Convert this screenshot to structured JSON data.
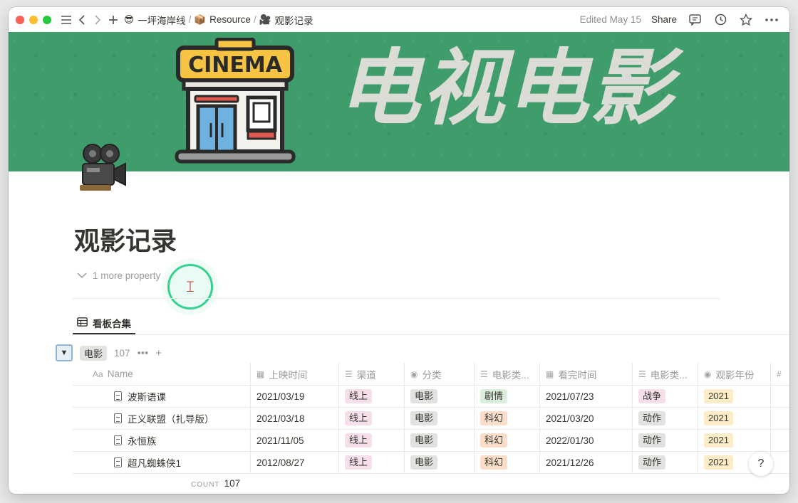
{
  "window": {
    "traffic_colors": [
      "#fe5f57",
      "#febc2e",
      "#28c840"
    ]
  },
  "topbar": {
    "breadcrumbs": [
      {
        "emoji": "😎",
        "label": "一坪海岸线"
      },
      {
        "emoji": "📦",
        "label": "Resource"
      },
      {
        "emoji": "🎥",
        "label": "观影记录"
      }
    ],
    "separator": "/",
    "edited": "Edited May 15",
    "share": "Share"
  },
  "cover": {
    "title": "电视电影",
    "sign_text": "CINEMA",
    "bg_color": "#3f9c6b"
  },
  "page": {
    "icon": "movie-camera-icon",
    "title": "观影记录",
    "more_property": "1 more property"
  },
  "view": {
    "tab_label": "看板合集"
  },
  "group": {
    "tag": "电影",
    "count": "107"
  },
  "table": {
    "columns": [
      {
        "icon": "Aa",
        "label": "Name"
      },
      {
        "icon": "▦",
        "label": "上映时间"
      },
      {
        "icon": "☰",
        "label": "渠道"
      },
      {
        "icon": "◉",
        "label": "分类"
      },
      {
        "icon": "☰",
        "label": "电影类..."
      },
      {
        "icon": "▦",
        "label": "看完时间"
      },
      {
        "icon": "☰",
        "label": "电影类..."
      },
      {
        "icon": "◉",
        "label": "观影年份"
      },
      {
        "icon": "#",
        "label": ""
      }
    ],
    "rows": [
      {
        "name": "波斯语课",
        "release": "2021/03/19",
        "channel": "线上",
        "category": "电影",
        "type1": "剧情",
        "finished": "2021/07/23",
        "type2": "战争",
        "year": "2021"
      },
      {
        "name": "正义联盟（扎导版）",
        "release": "2021/03/18",
        "channel": "线上",
        "category": "电影",
        "type1": "科幻",
        "finished": "2021/03/20",
        "type2": "动作",
        "year": "2021"
      },
      {
        "name": "永恒族",
        "release": "2021/11/05",
        "channel": "线上",
        "category": "电影",
        "type1": "科幻",
        "finished": "2022/01/30",
        "type2": "动作",
        "year": "2021"
      },
      {
        "name": "超凡蜘蛛侠1",
        "release": "2012/08/27",
        "channel": "线上",
        "category": "电影",
        "type1": "科幻",
        "finished": "2021/12/26",
        "type2": "动作",
        "year": "2021"
      }
    ],
    "count_label": "COUNT",
    "count_value": "107"
  },
  "help": "?"
}
